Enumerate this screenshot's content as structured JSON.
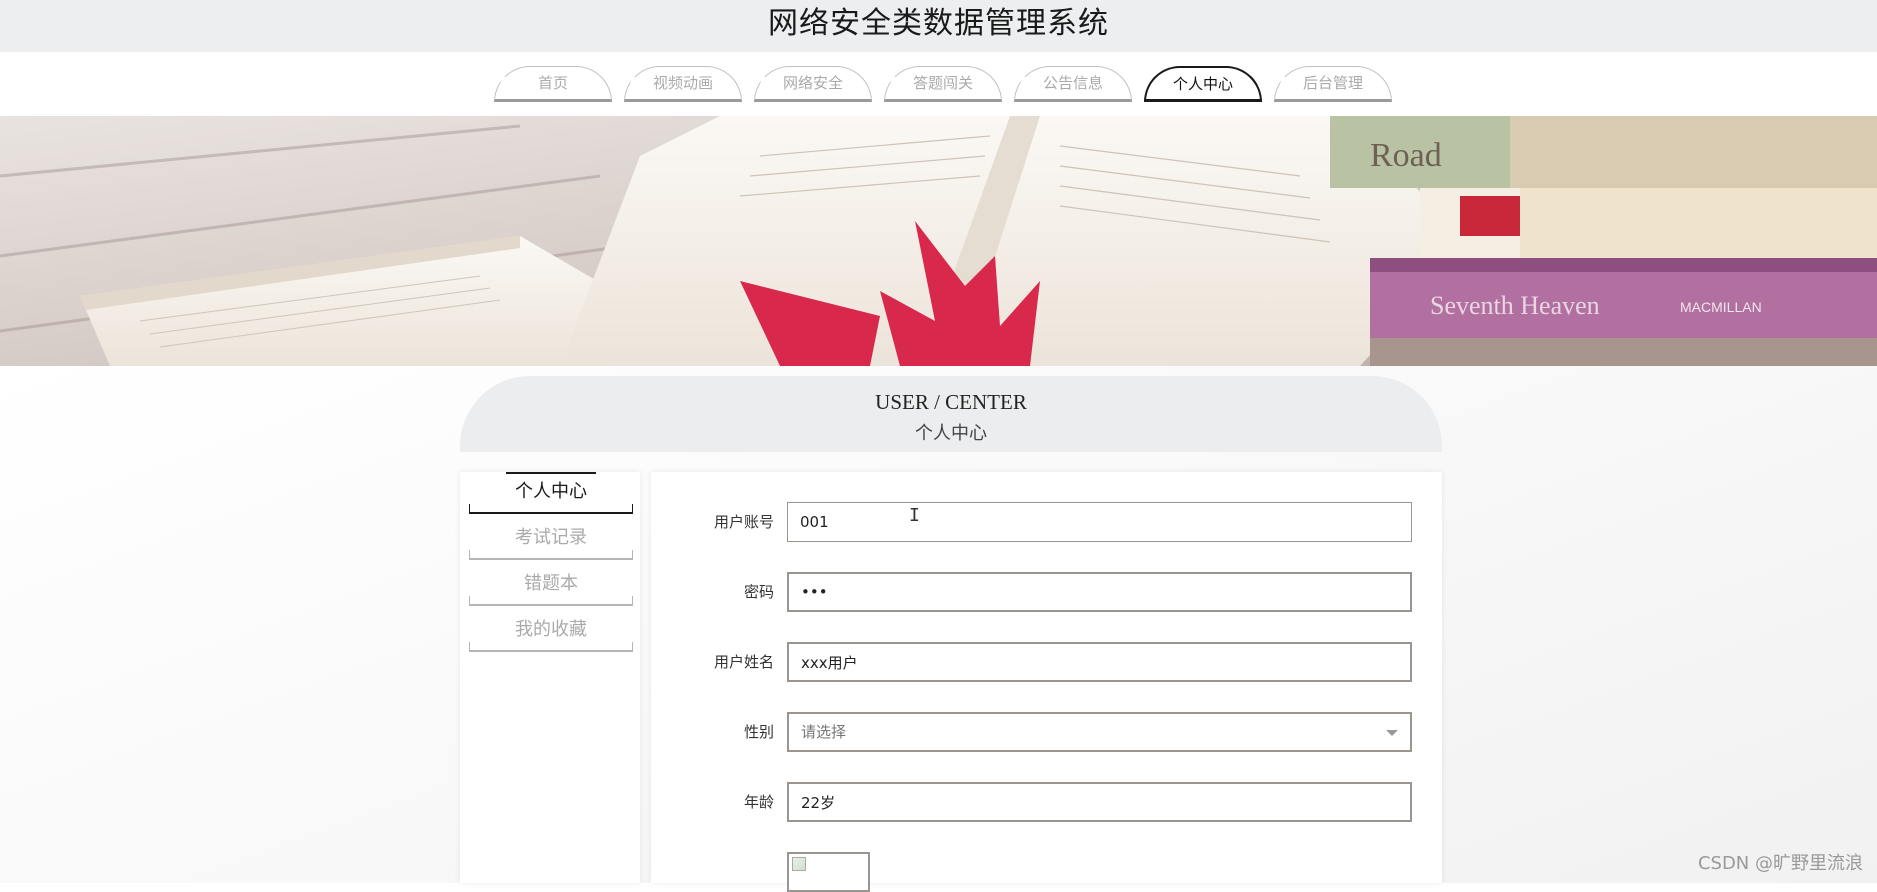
{
  "site": {
    "title": "网络安全类数据管理系统"
  },
  "nav": {
    "items": [
      {
        "label": "首页",
        "active": false
      },
      {
        "label": "视频动画",
        "active": false
      },
      {
        "label": "网络安全",
        "active": false
      },
      {
        "label": "答题闯关",
        "active": false
      },
      {
        "label": "公告信息",
        "active": false
      },
      {
        "label": "个人中心",
        "active": true
      },
      {
        "label": "后台管理",
        "active": false
      }
    ]
  },
  "banner": {
    "book_cover_text_1": "Road",
    "book_cover_text_2": "Seventh Heaven",
    "book_cover_text_3": "MACMILLAN"
  },
  "center": {
    "heading_en": "USER / CENTER",
    "heading_cn": "个人中心"
  },
  "sidebar": {
    "items": [
      {
        "label": "个人中心",
        "active": true
      },
      {
        "label": "考试记录",
        "active": false
      },
      {
        "label": "错题本",
        "active": false
      },
      {
        "label": "我的收藏",
        "active": false
      }
    ]
  },
  "form": {
    "account": {
      "label": "用户账号",
      "value": "001"
    },
    "password": {
      "label": "密码",
      "value": "•••"
    },
    "name": {
      "label": "用户姓名",
      "value": "xxx用户"
    },
    "gender": {
      "label": "性别",
      "value": "请选择"
    },
    "age": {
      "label": "年龄",
      "value": "22岁"
    }
  },
  "watermark": "CSDN @旷野里流浪",
  "colors": {
    "header_bg": "#eceef0",
    "active_border": "#1a1a1a",
    "input_border": "#9a968f",
    "inactive_text": "#aaaaaa"
  }
}
